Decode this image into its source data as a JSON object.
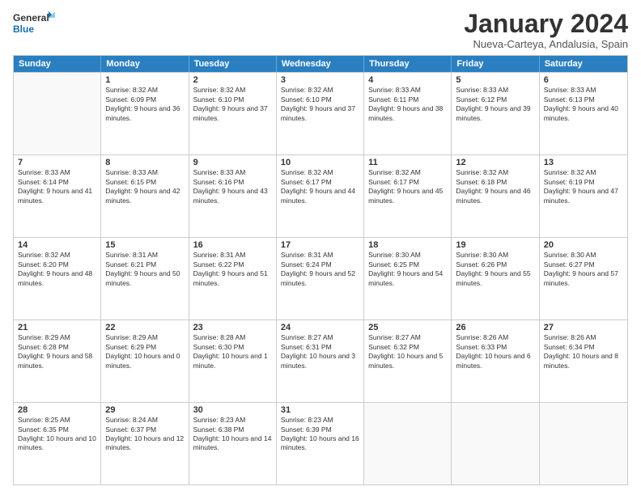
{
  "logo": {
    "line1": "General",
    "line2": "Blue"
  },
  "title": "January 2024",
  "subtitle": "Nueva-Carteya, Andalusia, Spain",
  "header_days": [
    "Sunday",
    "Monday",
    "Tuesday",
    "Wednesday",
    "Thursday",
    "Friday",
    "Saturday"
  ],
  "weeks": [
    [
      {
        "day": "",
        "sunrise": "",
        "sunset": "",
        "daylight": ""
      },
      {
        "day": "1",
        "sunrise": "Sunrise: 8:32 AM",
        "sunset": "Sunset: 6:09 PM",
        "daylight": "Daylight: 9 hours and 36 minutes."
      },
      {
        "day": "2",
        "sunrise": "Sunrise: 8:32 AM",
        "sunset": "Sunset: 6:10 PM",
        "daylight": "Daylight: 9 hours and 37 minutes."
      },
      {
        "day": "3",
        "sunrise": "Sunrise: 8:32 AM",
        "sunset": "Sunset: 6:10 PM",
        "daylight": "Daylight: 9 hours and 37 minutes."
      },
      {
        "day": "4",
        "sunrise": "Sunrise: 8:33 AM",
        "sunset": "Sunset: 6:11 PM",
        "daylight": "Daylight: 9 hours and 38 minutes."
      },
      {
        "day": "5",
        "sunrise": "Sunrise: 8:33 AM",
        "sunset": "Sunset: 6:12 PM",
        "daylight": "Daylight: 9 hours and 39 minutes."
      },
      {
        "day": "6",
        "sunrise": "Sunrise: 8:33 AM",
        "sunset": "Sunset: 6:13 PM",
        "daylight": "Daylight: 9 hours and 40 minutes."
      }
    ],
    [
      {
        "day": "7",
        "sunrise": "Sunrise: 8:33 AM",
        "sunset": "Sunset: 6:14 PM",
        "daylight": "Daylight: 9 hours and 41 minutes."
      },
      {
        "day": "8",
        "sunrise": "Sunrise: 8:33 AM",
        "sunset": "Sunset: 6:15 PM",
        "daylight": "Daylight: 9 hours and 42 minutes."
      },
      {
        "day": "9",
        "sunrise": "Sunrise: 8:33 AM",
        "sunset": "Sunset: 6:16 PM",
        "daylight": "Daylight: 9 hours and 43 minutes."
      },
      {
        "day": "10",
        "sunrise": "Sunrise: 8:32 AM",
        "sunset": "Sunset: 6:17 PM",
        "daylight": "Daylight: 9 hours and 44 minutes."
      },
      {
        "day": "11",
        "sunrise": "Sunrise: 8:32 AM",
        "sunset": "Sunset: 6:17 PM",
        "daylight": "Daylight: 9 hours and 45 minutes."
      },
      {
        "day": "12",
        "sunrise": "Sunrise: 8:32 AM",
        "sunset": "Sunset: 6:18 PM",
        "daylight": "Daylight: 9 hours and 46 minutes."
      },
      {
        "day": "13",
        "sunrise": "Sunrise: 8:32 AM",
        "sunset": "Sunset: 6:19 PM",
        "daylight": "Daylight: 9 hours and 47 minutes."
      }
    ],
    [
      {
        "day": "14",
        "sunrise": "Sunrise: 8:32 AM",
        "sunset": "Sunset: 6:20 PM",
        "daylight": "Daylight: 9 hours and 48 minutes."
      },
      {
        "day": "15",
        "sunrise": "Sunrise: 8:31 AM",
        "sunset": "Sunset: 6:21 PM",
        "daylight": "Daylight: 9 hours and 50 minutes."
      },
      {
        "day": "16",
        "sunrise": "Sunrise: 8:31 AM",
        "sunset": "Sunset: 6:22 PM",
        "daylight": "Daylight: 9 hours and 51 minutes."
      },
      {
        "day": "17",
        "sunrise": "Sunrise: 8:31 AM",
        "sunset": "Sunset: 6:24 PM",
        "daylight": "Daylight: 9 hours and 52 minutes."
      },
      {
        "day": "18",
        "sunrise": "Sunrise: 8:30 AM",
        "sunset": "Sunset: 6:25 PM",
        "daylight": "Daylight: 9 hours and 54 minutes."
      },
      {
        "day": "19",
        "sunrise": "Sunrise: 8:30 AM",
        "sunset": "Sunset: 6:26 PM",
        "daylight": "Daylight: 9 hours and 55 minutes."
      },
      {
        "day": "20",
        "sunrise": "Sunrise: 8:30 AM",
        "sunset": "Sunset: 6:27 PM",
        "daylight": "Daylight: 9 hours and 57 minutes."
      }
    ],
    [
      {
        "day": "21",
        "sunrise": "Sunrise: 8:29 AM",
        "sunset": "Sunset: 6:28 PM",
        "daylight": "Daylight: 9 hours and 58 minutes."
      },
      {
        "day": "22",
        "sunrise": "Sunrise: 8:29 AM",
        "sunset": "Sunset: 6:29 PM",
        "daylight": "Daylight: 10 hours and 0 minutes."
      },
      {
        "day": "23",
        "sunrise": "Sunrise: 8:28 AM",
        "sunset": "Sunset: 6:30 PM",
        "daylight": "Daylight: 10 hours and 1 minute."
      },
      {
        "day": "24",
        "sunrise": "Sunrise: 8:27 AM",
        "sunset": "Sunset: 6:31 PM",
        "daylight": "Daylight: 10 hours and 3 minutes."
      },
      {
        "day": "25",
        "sunrise": "Sunrise: 8:27 AM",
        "sunset": "Sunset: 6:32 PM",
        "daylight": "Daylight: 10 hours and 5 minutes."
      },
      {
        "day": "26",
        "sunrise": "Sunrise: 8:26 AM",
        "sunset": "Sunset: 6:33 PM",
        "daylight": "Daylight: 10 hours and 6 minutes."
      },
      {
        "day": "27",
        "sunrise": "Sunrise: 8:26 AM",
        "sunset": "Sunset: 6:34 PM",
        "daylight": "Daylight: 10 hours and 8 minutes."
      }
    ],
    [
      {
        "day": "28",
        "sunrise": "Sunrise: 8:25 AM",
        "sunset": "Sunset: 6:35 PM",
        "daylight": "Daylight: 10 hours and 10 minutes."
      },
      {
        "day": "29",
        "sunrise": "Sunrise: 8:24 AM",
        "sunset": "Sunset: 6:37 PM",
        "daylight": "Daylight: 10 hours and 12 minutes."
      },
      {
        "day": "30",
        "sunrise": "Sunrise: 8:23 AM",
        "sunset": "Sunset: 6:38 PM",
        "daylight": "Daylight: 10 hours and 14 minutes."
      },
      {
        "day": "31",
        "sunrise": "Sunrise: 8:23 AM",
        "sunset": "Sunset: 6:39 PM",
        "daylight": "Daylight: 10 hours and 16 minutes."
      },
      {
        "day": "",
        "sunrise": "",
        "sunset": "",
        "daylight": ""
      },
      {
        "day": "",
        "sunrise": "",
        "sunset": "",
        "daylight": ""
      },
      {
        "day": "",
        "sunrise": "",
        "sunset": "",
        "daylight": ""
      }
    ]
  ]
}
